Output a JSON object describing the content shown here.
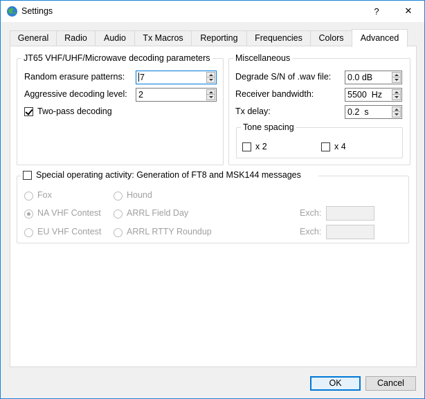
{
  "window": {
    "title": "Settings",
    "help_label": "?",
    "close_label": "✕",
    "accent_color": "#1883d7"
  },
  "tabs": [
    {
      "label": "General"
    },
    {
      "label": "Radio"
    },
    {
      "label": "Audio"
    },
    {
      "label": "Tx Macros"
    },
    {
      "label": "Reporting"
    },
    {
      "label": "Frequencies"
    },
    {
      "label": "Colors"
    },
    {
      "label": "Advanced",
      "active": true
    }
  ],
  "jt65_group": {
    "title": "JT65 VHF/UHF/Microwave decoding parameters",
    "random_erasure_label": "Random erasure patterns:",
    "random_erasure_value": "7",
    "aggressive_label": "Aggressive decoding level:",
    "aggressive_value": "2",
    "two_pass_label": "Two-pass decoding",
    "two_pass_checked": true
  },
  "misc_group": {
    "title": "Miscellaneous",
    "degrade_label": "Degrade S/N of .wav file:",
    "degrade_value": "0.0 dB",
    "bandwidth_label": "Receiver bandwidth:",
    "bandwidth_value": "5500  Hz",
    "txdelay_label": "Tx delay:",
    "txdelay_value": "0.2  s",
    "tone_spacing": {
      "title": "Tone spacing",
      "x2_label": "x 2",
      "x4_label": "x 4"
    }
  },
  "special_group": {
    "title": "Special operating activity:  Generation of FT8 and MSK144 messages",
    "options": {
      "fox": "Fox",
      "hound": "Hound",
      "na_vhf": "NA VHF Contest",
      "arrl_field": "ARRL Field Day",
      "eu_vhf": "EU VHF Contest",
      "arrl_rtty": "ARRL RTTY Roundup"
    },
    "exch_label_1": "Exch:",
    "exch_label_2": "Exch:"
  },
  "footer": {
    "ok_label": "OK",
    "cancel_label": "Cancel"
  }
}
